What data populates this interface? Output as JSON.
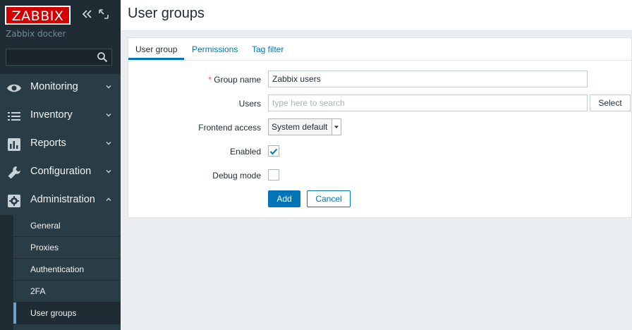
{
  "brand": {
    "logo_text": "ZABBIX",
    "server_name": "Zabbix docker",
    "accent": "#d40000"
  },
  "sidebar": {
    "search_placeholder": "",
    "menu": [
      {
        "label": "Monitoring",
        "icon": "eye-icon"
      },
      {
        "label": "Inventory",
        "icon": "list-icon"
      },
      {
        "label": "Reports",
        "icon": "bar-chart-icon"
      },
      {
        "label": "Configuration",
        "icon": "wrench-icon"
      },
      {
        "label": "Administration",
        "icon": "gear-icon",
        "expanded": true
      }
    ],
    "submenu": [
      {
        "label": "General"
      },
      {
        "label": "Proxies"
      },
      {
        "label": "Authentication"
      },
      {
        "label": "2FA"
      },
      {
        "label": "User groups",
        "active": true
      }
    ]
  },
  "page": {
    "title": "User groups"
  },
  "tabs": [
    {
      "label": "User group",
      "active": true
    },
    {
      "label": "Permissions"
    },
    {
      "label": "Tag filter"
    }
  ],
  "form": {
    "group_name_label": "Group name",
    "group_name_required_mark": "*",
    "group_name_value": "Zabbix users",
    "users_label": "Users",
    "users_placeholder": "type here to search",
    "users_select_button": "Select",
    "frontend_access_label": "Frontend access",
    "frontend_access_value": "System default",
    "enabled_label": "Enabled",
    "enabled_checked": true,
    "debug_mode_label": "Debug mode",
    "debug_mode_checked": false,
    "add_button": "Add",
    "cancel_button": "Cancel"
  },
  "colors": {
    "primary": "#0275b8",
    "sidebar_bg": "#1f2c33",
    "sidebar_item_bg": "#2a3d47"
  }
}
